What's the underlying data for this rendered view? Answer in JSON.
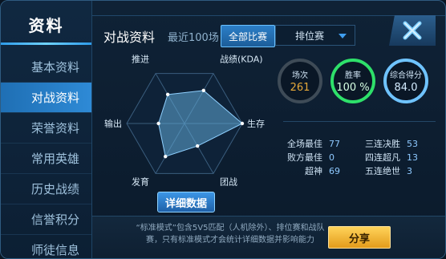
{
  "sidebar": {
    "title": "资料",
    "items": [
      {
        "label": "基本资料",
        "active": false
      },
      {
        "label": "对战资料",
        "active": true
      },
      {
        "label": "荣誉资料",
        "active": false
      },
      {
        "label": "常用英雄",
        "active": false
      },
      {
        "label": "历史战绩",
        "active": false
      },
      {
        "label": "信誉积分",
        "active": false
      },
      {
        "label": "师徒信息",
        "active": false
      }
    ]
  },
  "header": {
    "title": "对战资料",
    "subtitle": "最近100场",
    "filter_button": "全部比赛",
    "mode_select": "排位赛",
    "close_icon": "close-x-icon"
  },
  "radar": {
    "axes": [
      "推进",
      "战绩(KDA)",
      "生存",
      "团战",
      "发育",
      "输出"
    ],
    "values": [
      0.58,
      0.66,
      1.0,
      0.45,
      0.66,
      0.45
    ]
  },
  "detail_button": "详细数据",
  "stats": {
    "games": {
      "label": "场次",
      "value": "261",
      "color": "#e6a93a"
    },
    "win_rate": {
      "label": "胜率",
      "value": "100 %",
      "color": "#2ee06a"
    },
    "score": {
      "label": "综合得分",
      "value": "84.0",
      "color": "#6fc3ff"
    }
  },
  "records": {
    "left": [
      {
        "label": "全场最佳",
        "value": "77"
      },
      {
        "label": "败方最佳",
        "value": "0"
      },
      {
        "label": "超神",
        "value": "69"
      }
    ],
    "right": [
      {
        "label": "三连决胜",
        "value": "53"
      },
      {
        "label": "四连超凡",
        "value": "13"
      },
      {
        "label": "五连绝世",
        "value": "3"
      }
    ]
  },
  "notice": "“标准模式”包含5V5匹配（人机除外）、排位赛和战队赛，只有标准模式才会统计详细数据并影响能力",
  "share_button": "分享"
}
